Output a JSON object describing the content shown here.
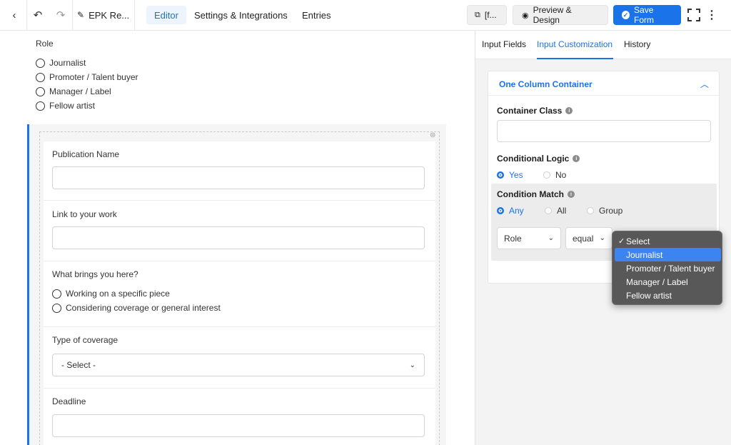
{
  "topbar": {
    "doc_title": "EPK Re...",
    "tabs": [
      "Editor",
      "Settings & Integrations",
      "Entries"
    ],
    "shortcode_label": "[f...",
    "preview_label": "Preview & Design",
    "save_label": "Save Form"
  },
  "canvas": {
    "role_label": "Role",
    "role_options": [
      "Journalist",
      "Promoter / Talent buyer",
      "Manager / Label",
      "Fellow artist"
    ],
    "fields": {
      "publication_label": "Publication Name",
      "link_label": "Link to your work",
      "brings_label": "What brings you here?",
      "brings_options": [
        "Working on a specific piece",
        "Considering coverage or general interest"
      ],
      "coverage_label": "Type of coverage",
      "coverage_value": "- Select -",
      "deadline_label": "Deadline"
    }
  },
  "panel": {
    "tabs": [
      "Input Fields",
      "Input Customization",
      "History"
    ],
    "card_title": "One Column Container",
    "container_class_label": "Container Class",
    "conditional_logic_label": "Conditional Logic",
    "conditional_options": [
      "Yes",
      "No"
    ],
    "condition_match_label": "Condition Match",
    "match_options": [
      "Any",
      "All",
      "Group"
    ],
    "rule_field": "Role",
    "rule_operator": "equal"
  },
  "popup": {
    "items": [
      "Select",
      "Journalist",
      "Promoter / Talent buyer",
      "Manager / Label",
      "Fellow artist"
    ],
    "checked_item": "Select",
    "highlighted_item": "Journalist"
  },
  "colors": {
    "accent": "#1a73e8",
    "popup_bg": "#585858",
    "popup_highlight": "#3c84f0"
  }
}
